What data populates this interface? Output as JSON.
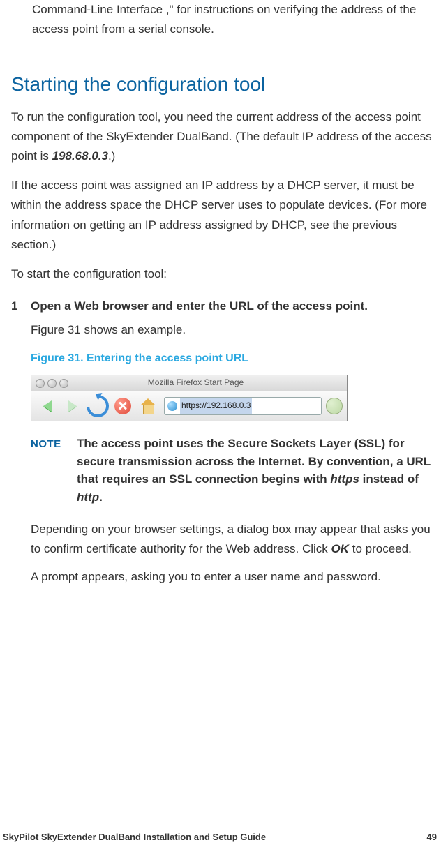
{
  "intro_tail": "Command-Line Interface ,\" for instructions on verifying the address of the access point from a serial console.",
  "heading": "Starting the configuration tool",
  "para1_a": "To run the configuration tool, you need the current address of the access point component of the SkyExtender DualBand. (The default IP address of the access point is ",
  "default_ip": "198.68.0.3",
  "para1_b": ".)",
  "para2": "If the access point was assigned an IP address by a DHCP server, it must be within the address space the DHCP server uses to populate devices. (For more information on getting an IP address assigned by DHCP, see the previous section.)",
  "para3": "To start the configuration tool:",
  "step1_num": "1",
  "step1_text": "Open a Web browser and enter the URL of the access point.",
  "step1_sub": "Figure 31 shows an example.",
  "figure_caption": "Figure 31. Entering the access point URL",
  "browser": {
    "title": "Mozilla Firefox Start Page",
    "url": "https://192.168.0.3"
  },
  "note_label": "NOTE",
  "note_a": "The access point uses the Secure Sockets Layer (SSL) for secure transmission across the Internet. By convention, a URL that requires an SSL connection begins with ",
  "note_https": "https",
  "note_mid": " instead of ",
  "note_http": "http",
  "note_end": ".",
  "after_note_a": "Depending on your browser settings, a dialog box may appear that asks you to confirm certificate authority for the Web address. Click ",
  "ok_label": "OK",
  "after_note_b": " to proceed.",
  "after_note2": "A prompt appears, asking you to enter a user name and password.",
  "footer_title": "SkyPilot SkyExtender DualBand Installation and Setup Guide",
  "footer_page": "49"
}
